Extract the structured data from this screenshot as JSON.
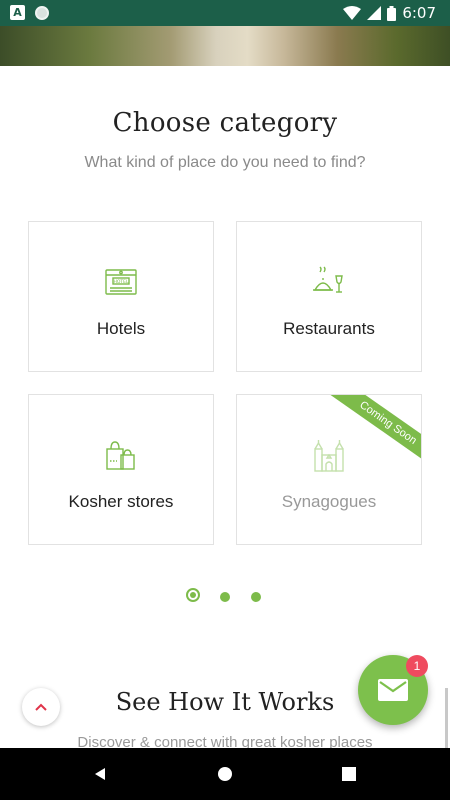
{
  "status_bar": {
    "time": "6:07",
    "left_icons": [
      "a-notification-icon",
      "circle-notification-icon"
    ],
    "right_icons": [
      "wifi-icon",
      "signal-icon",
      "battery-icon"
    ],
    "a_glyph": "A"
  },
  "category_section": {
    "title": "Choose category",
    "subtitle": "What kind of place do you need to find?",
    "categories": [
      {
        "label": "Hotels",
        "icon": "hotel-icon",
        "enabled": true
      },
      {
        "label": "Restaurants",
        "icon": "restaurant-icon",
        "enabled": true
      },
      {
        "label": "Kosher stores",
        "icon": "shopping-bags-icon",
        "enabled": true
      },
      {
        "label": "Synagogues",
        "icon": "synagogue-icon",
        "enabled": false,
        "ribbon": "Coming Soon"
      }
    ]
  },
  "pager": {
    "count": 3,
    "active_index": 0
  },
  "how_it_works": {
    "title": "See How It Works",
    "subtitle": "Discover & connect with great kosher places"
  },
  "fab": {
    "icon": "mail-icon",
    "badge_count": "1"
  },
  "colors": {
    "accent": "#7dbb4a",
    "status_bar": "#1c5f49",
    "badge": "#ef4b5f",
    "nav_bar": "#000000"
  }
}
